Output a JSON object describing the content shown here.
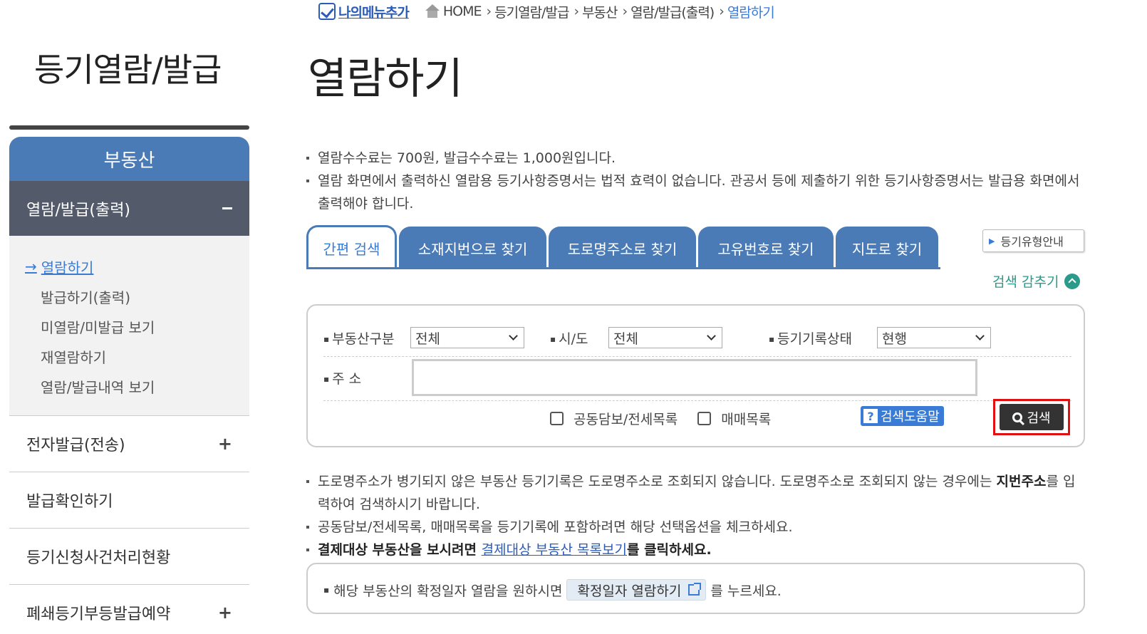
{
  "breadcrumb": {
    "my_menu": "나의메뉴추가",
    "items": [
      "HOME",
      "등기열람/발급",
      "부동산",
      "열람/발급(출력)"
    ],
    "current": "열람하기"
  },
  "left": {
    "title": "등기열람/발급",
    "section": "부동산",
    "active_group": "열람/발급(출력)",
    "sub_items": [
      "열람하기",
      "발급하기(출력)",
      "미열람/미발급 보기",
      "재열람하기",
      "열람/발급내역 보기"
    ],
    "groups": [
      {
        "label": "전자발급(전송)",
        "expand": "+"
      },
      {
        "label": "발급확인하기",
        "expand": ""
      },
      {
        "label": "등기신청사건처리현황",
        "expand": ""
      },
      {
        "label": "폐쇄등기부등발급예약",
        "expand": "+"
      }
    ]
  },
  "main": {
    "title": "열람하기",
    "notices": [
      "열람수수료는 700원, 발급수수료는 1,000원입니다.",
      "열람 화면에서 출력하신 열람용 등기사항증명서는 법적 효력이 없습니다. 관공서 등에 제출하기 위한 등기사항증명서는 발급용 화면에서 출력해야 합니다."
    ],
    "tabs": [
      "간편 검색",
      "소재지번으로 찾기",
      "도로명주소로 찾기",
      "고유번호로 찾기",
      "지도로 찾기"
    ],
    "type_guide": "등기유형안내",
    "hide_search": "검색 감추기",
    "form": {
      "property_type_label": "부동산구분",
      "property_type_value": "전체",
      "region_label": "시/도",
      "region_value": "전체",
      "status_label": "등기기록상태",
      "status_value": "현행",
      "address_label": "주 소",
      "address_value": "",
      "check_joint": "공동담보/전세목록",
      "check_trade": "매매목록",
      "help": "검색도움말",
      "search": "검색"
    },
    "notices2": {
      "line1_a": "도로명주소가 병기되지 않은 부동산 등기기록은 도로명주소로 조회되지 않습니다. 도로명주소로 조회되지 않는 경우에는 ",
      "line1_bold": "지번주소",
      "line1_b": "를 입력하여 검색하시기 바랍니다.",
      "line2": "공동담보/전세목록, 매매목록을 등기기록에 포함하려면 해당 선택옵션을 체크하세요.",
      "line3_a": "결제대상 부동산을 보시려면 ",
      "line3_link": "결제대상 부동산 목록보기",
      "line3_b": "를 클릭하세요."
    },
    "date_box": {
      "pre": "해당 부동산의 확정일자 열람을 원하시면",
      "button": "확정일자 열람하기",
      "post": "를 누르세요."
    }
  },
  "colors": {
    "primary": "#4a7bb7",
    "nav_active": "#535a6a",
    "link": "#3a7bd5",
    "accent_green": "#2a9a8a",
    "highlight_border": "#e01010"
  }
}
